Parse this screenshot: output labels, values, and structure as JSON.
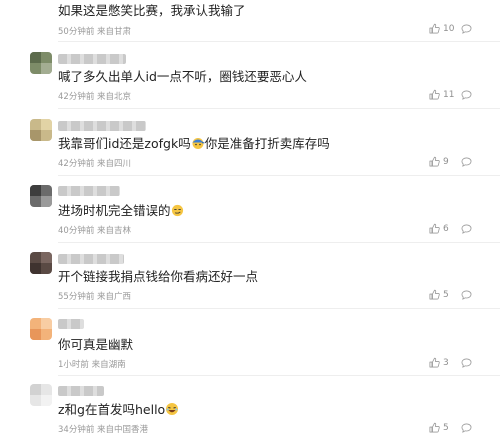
{
  "comments": [
    {
      "text": "如果这是憋笑比赛，我承认我输了",
      "meta": "50分钟前 来自甘肃",
      "likes": "10"
    },
    {
      "text": "喊了多久出单人id一点不听，圈钱还要恶心人",
      "meta": "42分钟前 来自北京",
      "likes": "11"
    },
    {
      "text_a": "我靠哥们id还是zofgk吗",
      "text_b": "你是准备打折卖库存吗",
      "meta": "42分钟前 来自四川",
      "likes": "9"
    },
    {
      "text": "进场时机完全错误的",
      "meta": "40分钟前 来自吉林",
      "likes": "6"
    },
    {
      "text": "开个链接我捐点钱给你看病还好一点",
      "meta": "55分钟前 来自广西",
      "likes": "5"
    },
    {
      "text": "你可真是幽默",
      "meta": "1小时前 来自湖南",
      "likes": "3"
    },
    {
      "text": "z和g在首发吗hello",
      "meta": "34分钟前 来自中国香港",
      "likes": "5"
    }
  ],
  "icons": {
    "like": "thumbs-up-icon",
    "reply": "comment-bubble-icon"
  },
  "colors": {
    "text": "#222222",
    "meta": "#999999",
    "divider": "#eeeeee"
  }
}
